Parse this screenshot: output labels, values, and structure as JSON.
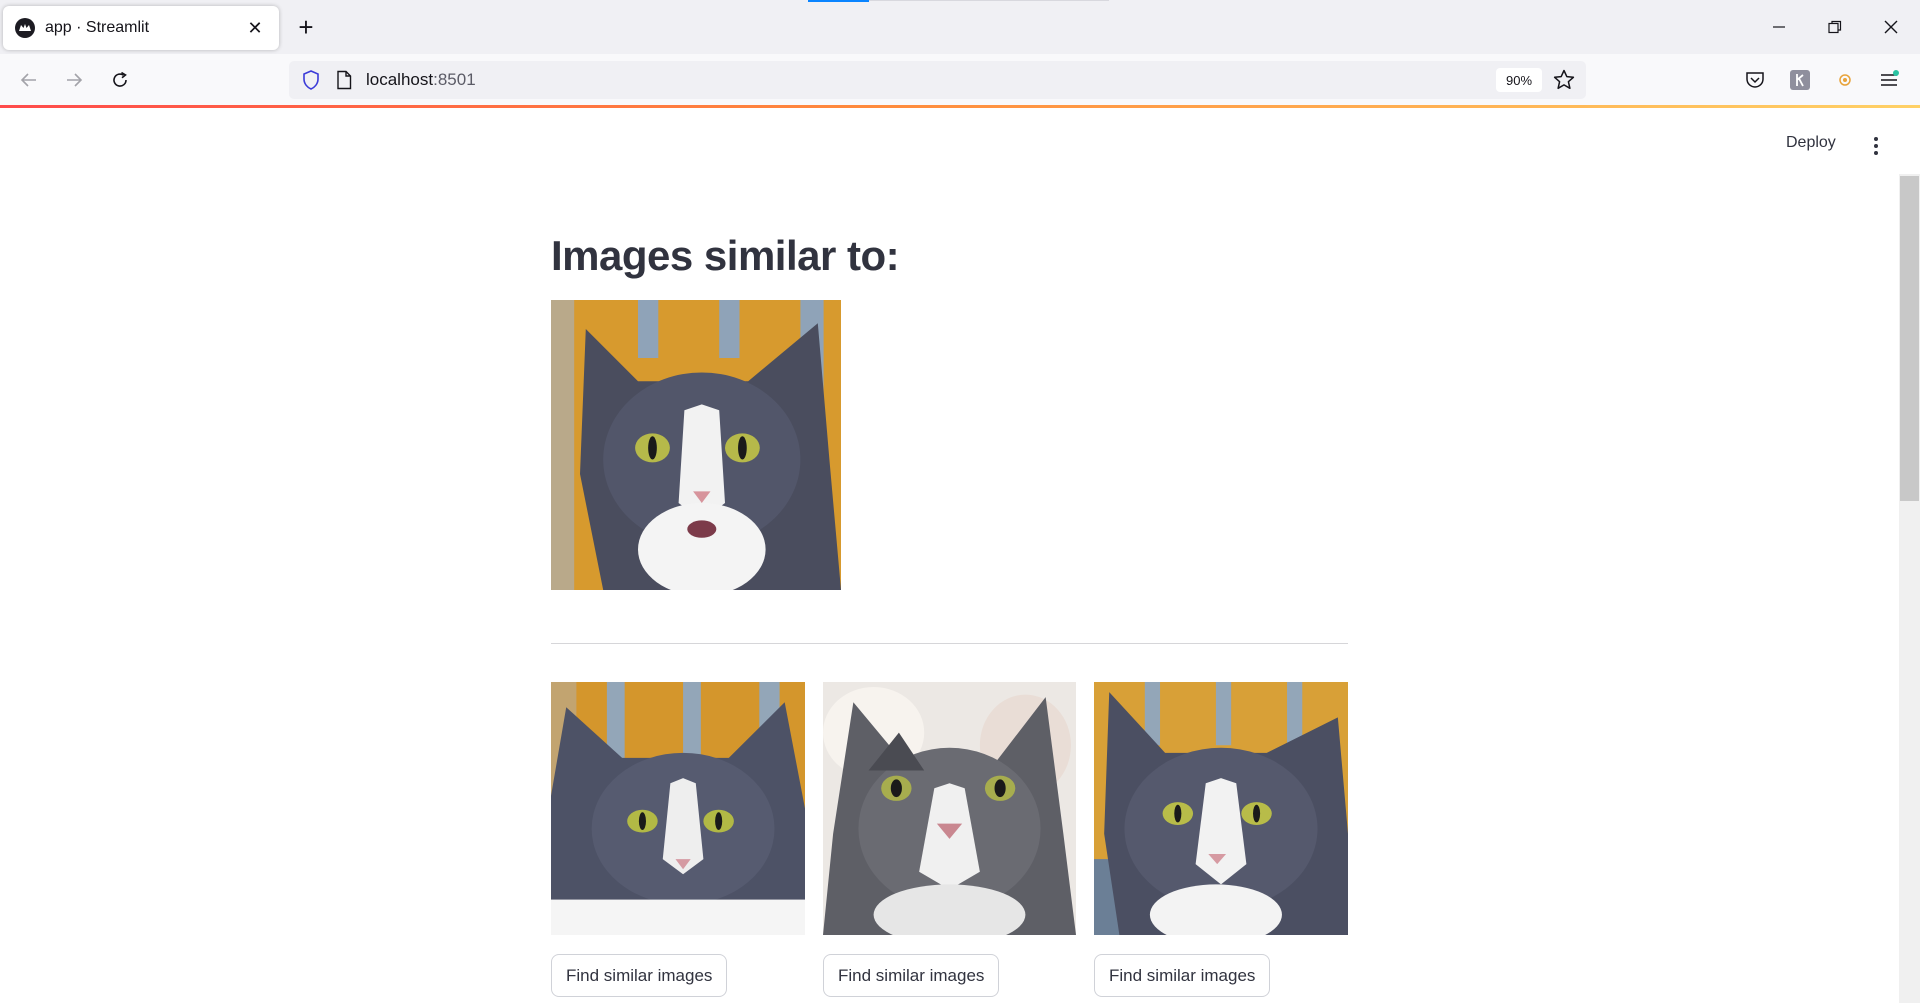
{
  "browser": {
    "tab_title": "app · Streamlit",
    "url_host": "localhost",
    "url_port": ":8501",
    "zoom": "90%",
    "icons": [
      "streamlit-favicon",
      "close-icon",
      "plus-icon",
      "minimize-icon",
      "restore-icon",
      "window-close-icon",
      "back-icon",
      "forward-icon",
      "reload-icon",
      "shield-icon",
      "page-icon",
      "star-icon",
      "pocket-icon",
      "extension-icon",
      "addon-icon",
      "menu-icon"
    ]
  },
  "app": {
    "deploy_label": "Deploy",
    "heading": "Images similar to:",
    "query_image": "gray-white-cat-orange-background",
    "results": [
      {
        "image": "gray-white-cat-orange-background",
        "button_label": "Find similar images"
      },
      {
        "image": "gray-white-cat-light-background",
        "button_label": "Find similar images"
      },
      {
        "image": "gray-white-cat-orange-background",
        "button_label": "Find similar images"
      }
    ]
  },
  "colors": {
    "accent_gradient_start": "#ff4b4b",
    "accent_gradient_end": "#ffd166",
    "text": "#31333f"
  }
}
